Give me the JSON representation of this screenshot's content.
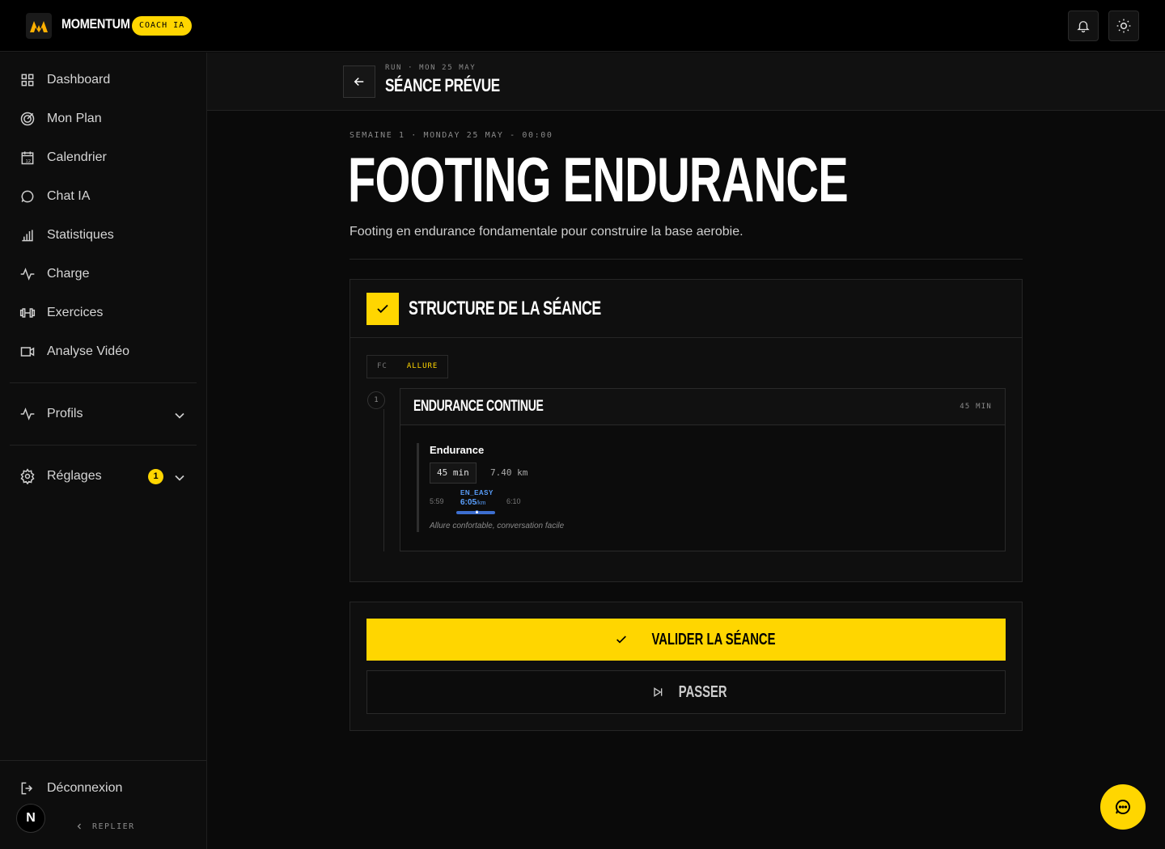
{
  "app": {
    "brand": "MOMENTUM",
    "badge": "COACH IA"
  },
  "sidebar": {
    "items": [
      {
        "label": "Dashboard",
        "icon": "grid-icon"
      },
      {
        "label": "Mon Plan",
        "icon": "target-icon"
      },
      {
        "label": "Calendrier",
        "icon": "calendar-icon"
      },
      {
        "label": "Chat IA",
        "icon": "chat-icon"
      },
      {
        "label": "Statistiques",
        "icon": "bar-chart-icon"
      },
      {
        "label": "Charge",
        "icon": "activity-icon"
      },
      {
        "label": "Exercices",
        "icon": "dumbbell-icon"
      },
      {
        "label": "Analyse Vidéo",
        "icon": "video-icon"
      }
    ],
    "profiles": "Profils",
    "settings": "Réglages",
    "settings_badge": "1",
    "logout": "Déconnexion",
    "avatar": "N",
    "collapse": "REPLIER"
  },
  "header": {
    "breadcrumb": "RUN · MON 25 MAY",
    "title": "SÉANCE PRÉVUE"
  },
  "session": {
    "meta": "SEMAINE 1 · MONDAY 25 MAY - 00:00",
    "title": "FOOTING ENDURANCE",
    "description": "Footing en endurance fondamentale pour construire la base aerobie."
  },
  "structure": {
    "title": "STRUCTURE DE LA SÉANCE",
    "toggle": {
      "fc": "FC",
      "pace": "ALLURE",
      "selected": "ALLURE"
    },
    "steps": [
      {
        "number": "1",
        "title": "ENDURANCE CONTINUE",
        "duration": "45 MIN",
        "segment": {
          "name": "Endurance",
          "duration": "45 min",
          "distance": "7.40 km",
          "pace_min": "5:59",
          "pace_max": "6:10",
          "zone": "EN_EASY",
          "pace": "6:05",
          "pace_unit": "/km",
          "hint": "Allure confortable, conversation facile"
        }
      }
    ]
  },
  "actions": {
    "validate": "VALIDER LA SÉANCE",
    "skip": "PASSER"
  },
  "colors": {
    "accent": "#ffd600",
    "pace": "#5aa0ff",
    "background": "#0a0a0a"
  }
}
